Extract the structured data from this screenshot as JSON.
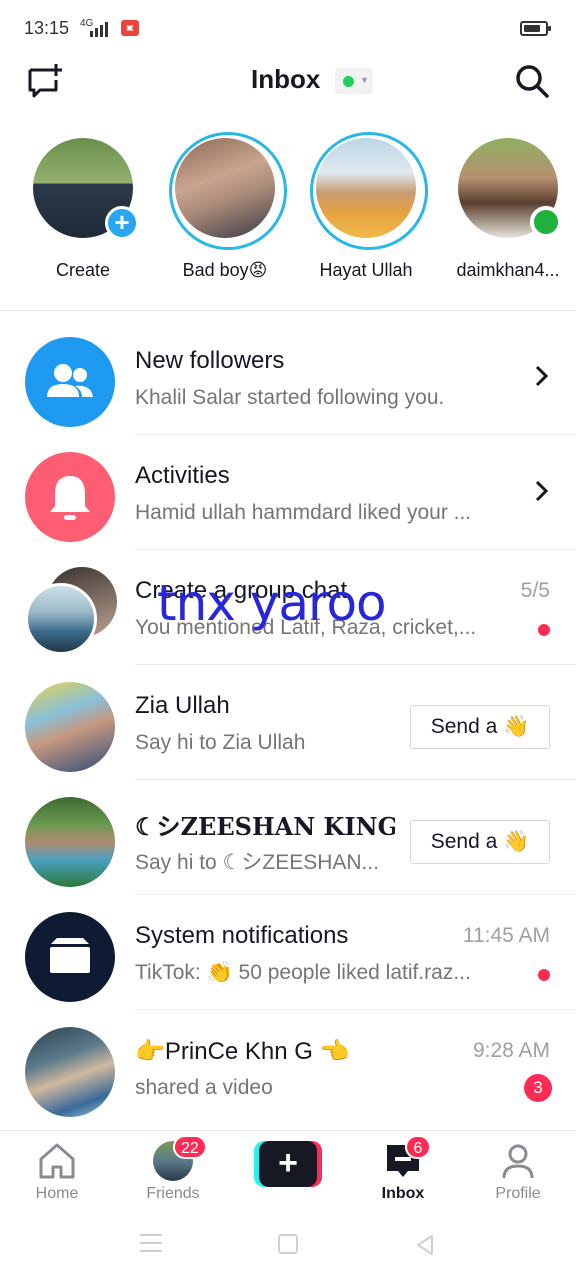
{
  "status_bar": {
    "time": "13:15",
    "network": "4G"
  },
  "header": {
    "title": "Inbox"
  },
  "stories": [
    {
      "name": "Create",
      "badge": "+"
    },
    {
      "name": "Bad boy😡"
    },
    {
      "name": "Hayat Ullah"
    },
    {
      "name": "daimkhan4..."
    }
  ],
  "messages": [
    {
      "title": "New followers",
      "subtitle": "Khalil Salar started following you."
    },
    {
      "title": "Activities",
      "subtitle": "Hamid ullah hammdard liked your ..."
    },
    {
      "title": "Create a group chat",
      "subtitle": "You mentioned Latif, Raza, cricket,...",
      "time": "5/5"
    },
    {
      "title": "Zia Ullah",
      "subtitle": "Say hi to Zia Ullah",
      "action": "Send a 👋"
    },
    {
      "title": "☾シZEESHAN KING☽",
      "subtitle": "Say hi to ☾シZEESHAN...",
      "action": "Send a 👋"
    },
    {
      "title": "System notifications",
      "subtitle": "TikTok: 👏 50 people liked latif.raz...",
      "time": "11:45 AM"
    },
    {
      "title": "👉PrinCe Khn G 👈",
      "subtitle": "shared a video",
      "time": "9:28 AM",
      "badge": "3"
    }
  ],
  "overlay_text": "tnx yaroo",
  "bottom_nav": {
    "home": "Home",
    "friends": "Friends",
    "friends_badge": "22",
    "create": "+",
    "inbox": "Inbox",
    "inbox_badge": "6",
    "profile": "Profile"
  },
  "colors": {
    "accent_red": "#fe2c55",
    "accent_blue": "#2aa5f2",
    "followers_icon_bg": "#1e9bf0",
    "activities_icon_bg": "#fe5d74",
    "system_icon_bg": "#0f1a33",
    "overlay_text": "#2727d9"
  }
}
